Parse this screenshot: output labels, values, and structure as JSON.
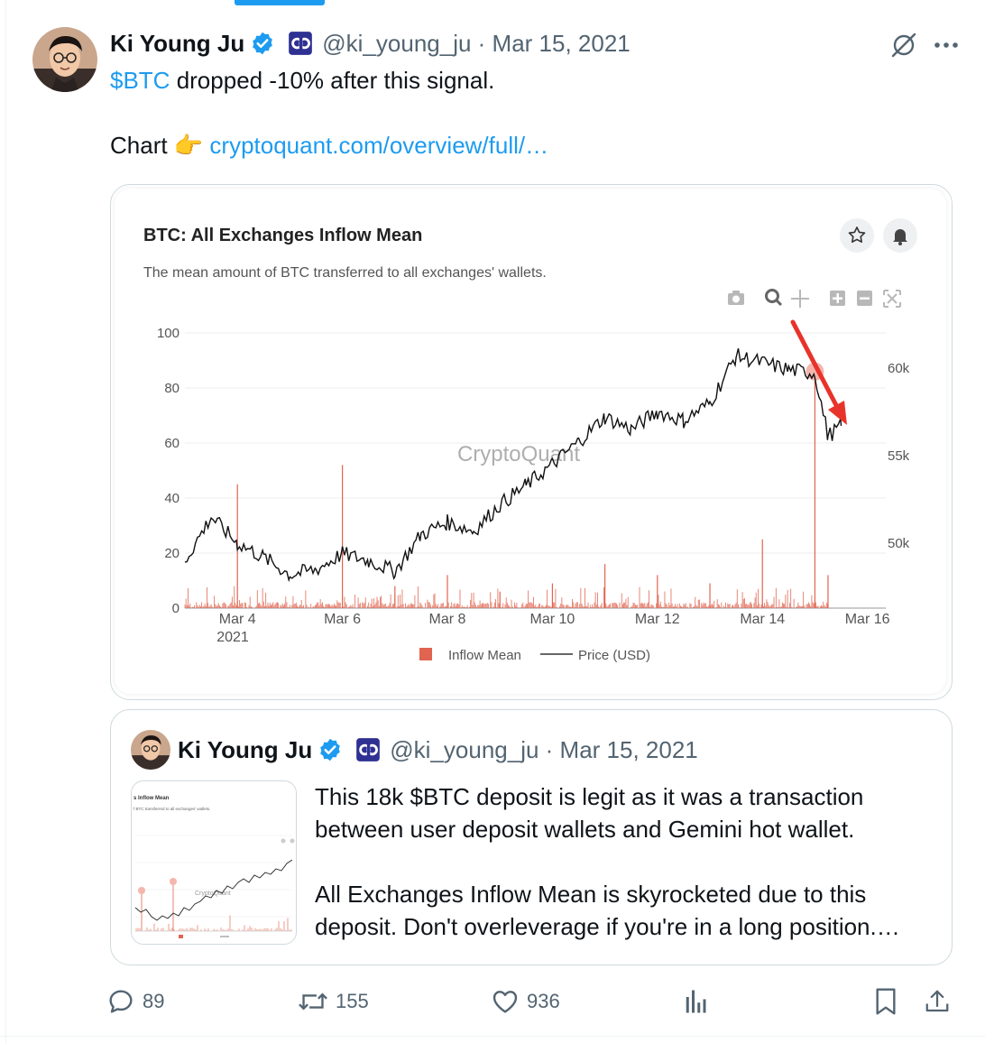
{
  "tweet": {
    "author_name": "Ki Young Ju",
    "handle_date": "@ki_young_ju · Mar 15, 2021",
    "line1_link": "$BTC",
    "line1_rest": " dropped -10% after this signal.",
    "line2_prefix": "Chart 👉 ",
    "line2_link": "cryptoquant.com/overview/full/…"
  },
  "chart_data": {
    "type": "line",
    "title": "BTC: All Exchanges Inflow Mean",
    "subtitle": "The mean amount of BTC transferred to all exchanges' wallets.",
    "watermark": "CryptoQuant",
    "x_ticks": [
      "Mar 4",
      "Mar 6",
      "Mar 8",
      "Mar 10",
      "Mar 12",
      "Mar 14",
      "Mar 16"
    ],
    "x_year": "2021",
    "y_left_ticks": [
      "0",
      "20",
      "40",
      "60",
      "80",
      "100"
    ],
    "y_right_ticks": [
      "50k",
      "55k",
      "60k"
    ],
    "ylim_left": [
      0,
      100
    ],
    "legend": {
      "inflow_label": "Inflow Mean",
      "price_label": "Price (USD)",
      "inflow_color": "#e0644f",
      "price_color": "#000000"
    },
    "series": [
      {
        "name": "Price (USD)",
        "x": [
          "Mar 3",
          "Mar 3 12:00",
          "Mar 4",
          "Mar 4 12:00",
          "Mar 5",
          "Mar 5 12:00",
          "Mar 6",
          "Mar 6 12:00",
          "Mar 7",
          "Mar 7 12:00",
          "Mar 8",
          "Mar 8 12:00",
          "Mar 9",
          "Mar 9 12:00",
          "Mar 10",
          "Mar 10 12:00",
          "Mar 11",
          "Mar 11 12:00",
          "Mar 12",
          "Mar 12 12:00",
          "Mar 13",
          "Mar 13 12:00",
          "Mar 14",
          "Mar 14 12:00",
          "Mar 15",
          "Mar 15 06:00",
          "Mar 15 12:00"
        ],
        "values": [
          49000,
          51500,
          50000,
          49200,
          48200,
          48500,
          49400,
          49000,
          48400,
          50500,
          51200,
          50700,
          52200,
          53300,
          54500,
          55800,
          57200,
          56500,
          57500,
          57000,
          58000,
          60700,
          60300,
          59900,
          59700,
          56100,
          56700
        ]
      },
      {
        "name": "Inflow Mean",
        "x": [
          "Mar 4",
          "Mar 6",
          "Mar 7",
          "Mar 8",
          "Mar 9",
          "Mar 10",
          "Mar 11",
          "Mar 12",
          "Mar 13",
          "Mar 14",
          "Mar 15",
          "Mar 15 06:00"
        ],
        "values": [
          45,
          52,
          8,
          12,
          6,
          9,
          16,
          12,
          9,
          25,
          88,
          12
        ],
        "highlight_marker": {
          "x": "Mar 15",
          "value": 86
        }
      }
    ]
  },
  "quote": {
    "author_name": "Ki Young Ju",
    "handle_date": "@ki_young_ju · Mar 15, 2021",
    "text_p1": "This 18k $BTC deposit is legit as it was a transaction between user deposit wallets and Gemini hot wallet.",
    "text_p2": "All Exchanges Inflow Mean is skyrocketed due to this deposit. Don't overleverage if you're in a long position.…",
    "thumb_title": "s Inflow Mean",
    "thumb_subtitle": "f BTC transferred to all exchanges' wallets.",
    "thumb_watermark": "CryptoQuant"
  },
  "actions": {
    "replies": "89",
    "retweets": "155",
    "likes": "936"
  },
  "colors": {
    "accent": "#1d9bf0",
    "muted": "#536471",
    "inflow": "#e0644f",
    "arrow": "#e8332a"
  },
  "icons": [
    "verified-badge-icon",
    "affiliate-badge-icon",
    "grok-icon",
    "more-icon",
    "star-icon",
    "bell-icon",
    "camera-icon",
    "zoom-icon",
    "pan-icon",
    "zoom-in-icon",
    "zoom-out-icon",
    "autoscale-icon",
    "reply-icon",
    "retweet-icon",
    "like-icon",
    "views-icon",
    "bookmark-icon",
    "share-icon"
  ]
}
